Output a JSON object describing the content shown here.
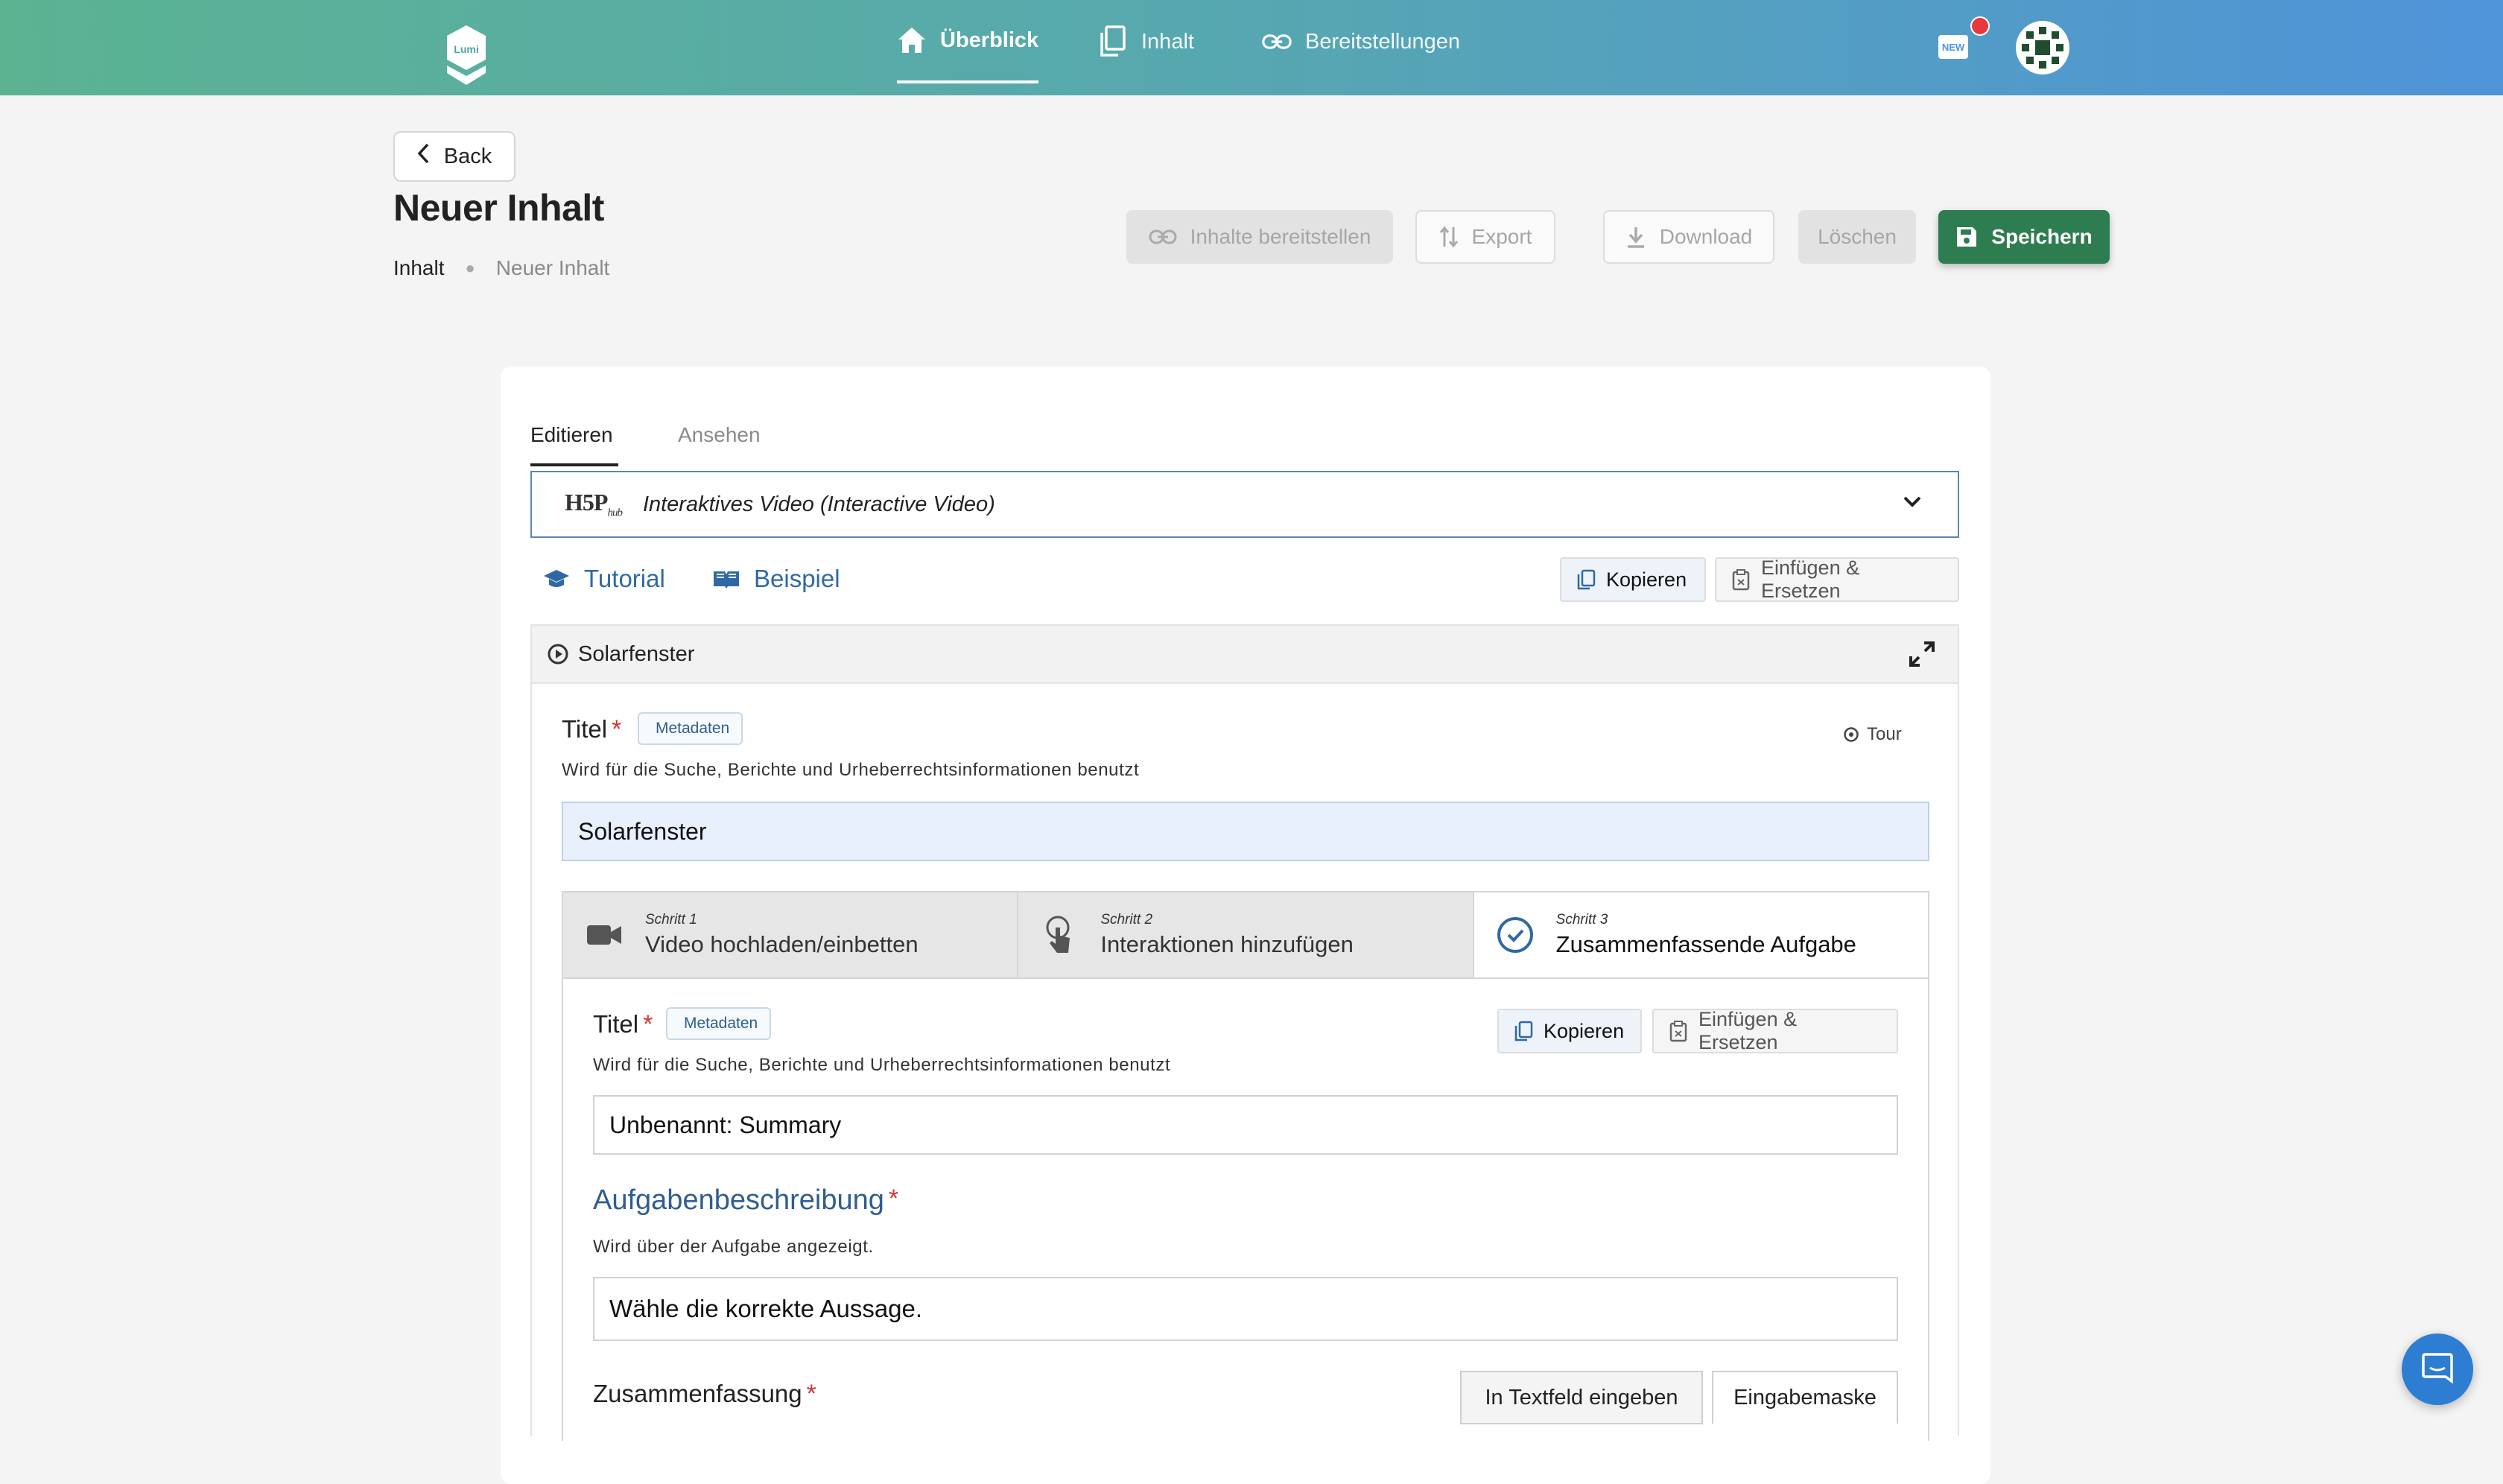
{
  "nav": {
    "items": [
      {
        "label": "Überblick",
        "icon": "home-icon",
        "active": true
      },
      {
        "label": "Inhalt",
        "icon": "copy-icon",
        "active": false
      },
      {
        "label": "Bereitstellungen",
        "icon": "link-icon",
        "active": false
      }
    ],
    "logo_text": "Lumi",
    "new_badge": "NEW"
  },
  "header": {
    "back_label": "Back",
    "title": "Neuer Inhalt",
    "breadcrumb": [
      "Inhalt",
      "Neuer Inhalt"
    ],
    "actions": {
      "share": "Inhalte bereitstellen",
      "export": "Export",
      "download": "Download",
      "delete": "Löschen",
      "save": "Speichern"
    }
  },
  "editor": {
    "tabs": [
      "Editieren",
      "Ansehen"
    ],
    "hub_logo": "H5P",
    "hub_logo_sub": "hub",
    "content_type": "Interaktives Video (Interactive Video)",
    "tutorial": "Tutorial",
    "example": "Beispiel",
    "copy": "Kopieren",
    "paste_replace": "Einfügen & Ersetzen",
    "section_title": "Solarfenster",
    "title_label": "Titel",
    "metadata": "Metadaten",
    "tour": "Tour",
    "title_hint": "Wird für die Suche, Berichte und Urheberrechtsinformationen benutzt",
    "title_value": "Solarfenster",
    "steps": [
      {
        "sub": "Schritt 1",
        "label": "Video hochladen/einbetten",
        "icon": "video-camera-icon"
      },
      {
        "sub": "Schritt 2",
        "label": "Interaktionen hinzufügen",
        "icon": "pointer-hand-icon"
      },
      {
        "sub": "Schritt 3",
        "label": "Zusammenfassende Aufgabe",
        "icon": "check-circle-icon"
      }
    ],
    "summary": {
      "title_label": "Titel",
      "metadata": "Metadaten",
      "copy": "Kopieren",
      "paste_replace": "Einfügen & Ersetzen",
      "title_hint": "Wird für die Suche, Berichte und Urheberrechtsinformationen benutzt",
      "title_value": "Unbenannt: Summary",
      "task_label": "Aufgabenbeschreibung",
      "task_hint": "Wird über der Aufgabe angezeigt.",
      "task_value": "Wähle die korrekte Aussage.",
      "summary_label": "Zusammenfassung",
      "mode_text": "In Textfeld eingeben",
      "mode_form": "Eingabemaske"
    }
  },
  "colors": {
    "gradient_start": "#5bb392",
    "gradient_end": "#4f93d9",
    "save_green": "#2e7d50",
    "link_blue": "#2f69a5",
    "required_red": "#d23434"
  }
}
